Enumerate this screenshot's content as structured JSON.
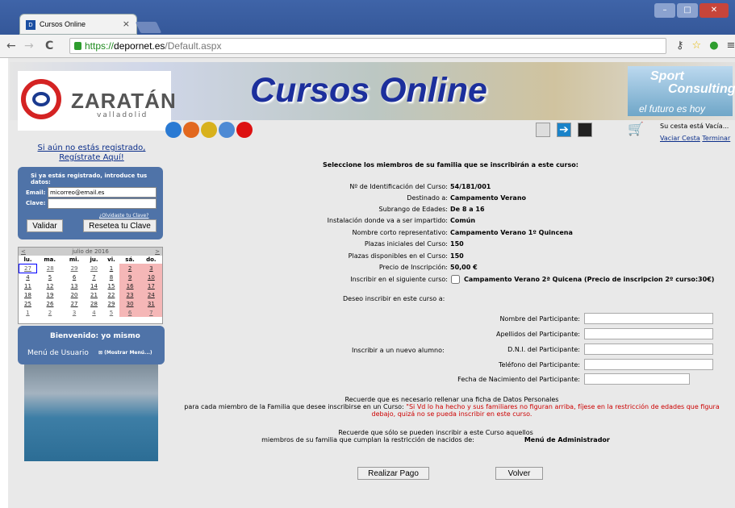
{
  "browser": {
    "tab_title": "Cursos Online",
    "tab_close": "×",
    "url_scheme": "https://",
    "url_host": "depornet.es",
    "url_path": "/Default.aspx"
  },
  "header": {
    "logo_name": "ZARATÁN",
    "logo_city": "valladolid",
    "title": "Cursos Online",
    "sponsor_line1": "Sport",
    "sponsor_line2": "Consulting",
    "sponsor_line3": "el futuro es hoy"
  },
  "cart": {
    "status": "Su cesta está Vacía...",
    "empty_link": "Vaciar Cesta",
    "finish_link": "Terminar"
  },
  "sidebar": {
    "register_line1": "Si aún no estás registrado,",
    "register_line2": "Regístrate Aquí!",
    "login_header": "Si ya estás registrado, introduce tus datos:",
    "email_label": "Email:",
    "email_value": "micorreo@email.es",
    "password_label": "Clave:",
    "forgot_link": "¿Olvidaste tu Clave?",
    "validate_button": "Validar",
    "reset_button": "Resetea tu Clave",
    "welcome": "Bienvenido: yo mismo",
    "user_menu": "Menú de Usuario",
    "show_menu": "(Mostrar Menú...)"
  },
  "calendar": {
    "prev": "<",
    "next": ">",
    "month": "julio de 2016",
    "days": [
      "lu.",
      "ma.",
      "mi.",
      "ju.",
      "vi.",
      "sá.",
      "do."
    ],
    "weeks": [
      [
        "27",
        "28",
        "29",
        "30",
        "1",
        "2",
        "3"
      ],
      [
        "4",
        "5",
        "6",
        "7",
        "8",
        "9",
        "10"
      ],
      [
        "11",
        "12",
        "13",
        "14",
        "15",
        "16",
        "17"
      ],
      [
        "18",
        "19",
        "20",
        "21",
        "22",
        "23",
        "24"
      ],
      [
        "25",
        "26",
        "27",
        "28",
        "29",
        "30",
        "31"
      ],
      [
        "1",
        "2",
        "3",
        "4",
        "5",
        "6",
        "7"
      ]
    ]
  },
  "main": {
    "heading": "Seleccione los miembros de su familia que se inscribirán a este curso:",
    "fields": [
      {
        "label": "Nº de Identificación del Curso:",
        "value": "54/181/001"
      },
      {
        "label": "Destinado a:",
        "value": "Campamento Verano"
      },
      {
        "label": "Subrango de Edades:",
        "value": "De 8 a 16"
      },
      {
        "label": "Instalación donde va a ser impartido:",
        "value": "Común"
      },
      {
        "label": "Nombre corto representativo:",
        "value": "Campamento Verano 1º Quincena"
      },
      {
        "label": "Plazas iniciales del Curso:",
        "value": "150"
      },
      {
        "label": "Plazas disponibles en el Curso:",
        "value": "150"
      },
      {
        "label": "Precio de Inscripción:",
        "value": "50,00 €"
      },
      {
        "label": "Inscribir en el siguiente curso:",
        "value": "Campamento Verano 2ª Quicena (Precio de inscripcion 2º curso:30€)"
      }
    ],
    "enroll_label": "Deseo inscribir en este curso a:",
    "new_student_label": "Inscribir a un nuevo alumno:",
    "participant_fields": [
      "Nombre del Participante:",
      "Apellidos del Participante:",
      "D.N.I. del Participante:",
      "Teléfono del Participante:",
      "Fecha de Nacimiento del Participante:"
    ],
    "note1_line1": "Recuerde que es necesario rellenar una ficha de Datos Personales",
    "note1_line2": "para cada miembro de la Familia que desee inscribirse en un Curso:",
    "note1_red_line1": "\"Si Vd lo ha hecho y sus familiares no figuran arriba, fíjese en la restricción de edades que figura",
    "note1_red_line2": "debajo, quizá no se pueda inscribir en este curso.",
    "note2_line1": "Recuerde que sólo se pueden inscribir a este Curso aquellos",
    "note2_line2": "miembros de su familia que cumplan la restricción de nacidos de:",
    "admin_menu": "Menú de Administrador",
    "pay_button": "Realizar Pago",
    "back_button": "Volver"
  }
}
